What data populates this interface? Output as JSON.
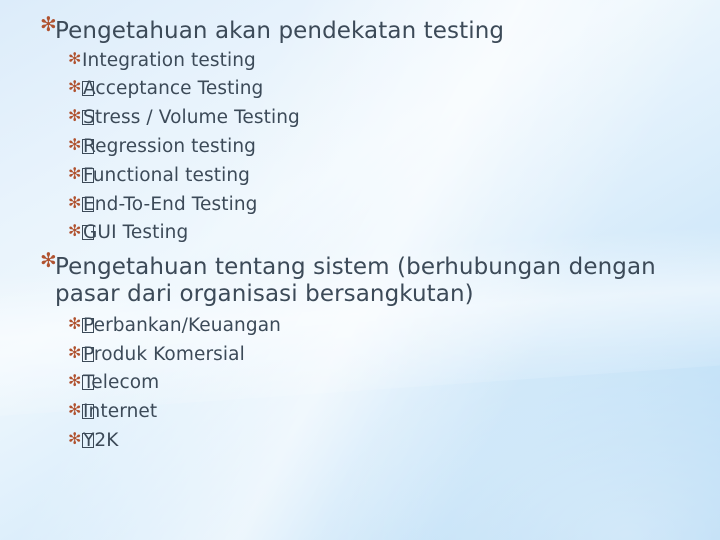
{
  "slide": {
    "background_colors": {
      "top_left": "#dcecfa",
      "top_right": "#e9f4fd",
      "bottom_left": "#b6daf5",
      "bottom_right": "#bfe0f7"
    },
    "bullet_color": "#b0522f",
    "text_color": "#3c4a58",
    "bullet_glyph": "✻",
    "missing_glyph_name": "tofu-box"
  },
  "sections": [
    {
      "heading": "Pengetahuan akan pendekatan testing",
      "items": [
        {
          "text": "Integration testing",
          "tofu": false
        },
        {
          "text": "Acceptance Testing",
          "tofu": true
        },
        {
          "text": "Stress / Volume Testing",
          "tofu": true
        },
        {
          "text": "Regression testing",
          "tofu": true
        },
        {
          "text": "Functional testing",
          "tofu": true
        },
        {
          "text": "End-To-End Testing",
          "tofu": true
        },
        {
          "text": "GUI Testing",
          "tofu": true
        }
      ]
    },
    {
      "heading": "Pengetahuan tentang sistem (berhubungan dengan pasar dari organisasi bersangkutan)",
      "items": [
        {
          "text": "Perbankan/Keuangan",
          "tofu": true
        },
        {
          "text": "Produk Komersial",
          "tofu": true
        },
        {
          "text": "Telecom",
          "tofu": true
        },
        {
          "text": "Internet",
          "tofu": true
        },
        {
          "text": "Y2K",
          "tofu": true
        }
      ]
    }
  ]
}
